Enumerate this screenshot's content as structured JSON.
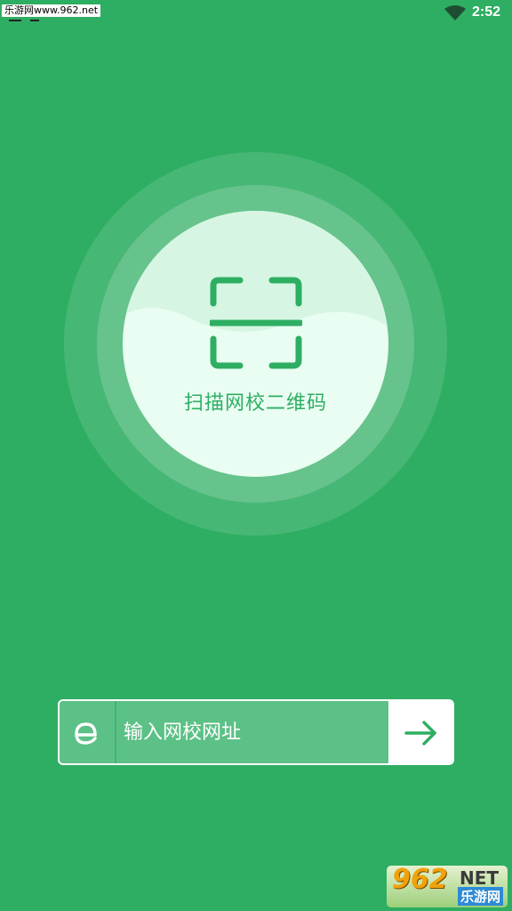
{
  "statusbar": {
    "watermark": "乐游网www.962.net",
    "time": "2:52"
  },
  "scan": {
    "label": "扫描网校二维码",
    "icon": "scan-qr-icon"
  },
  "url_bar": {
    "placeholder": "输入网校网址",
    "value": "",
    "left_icon": "browser-e-icon",
    "go_icon": "arrow-right-icon"
  },
  "watermark_br": {
    "number": "962",
    "suffix": "NET",
    "cn": "乐游网"
  },
  "colors": {
    "primary": "#2eae62",
    "circle": "#e9fdf2",
    "input_bg": "#5cc186"
  }
}
